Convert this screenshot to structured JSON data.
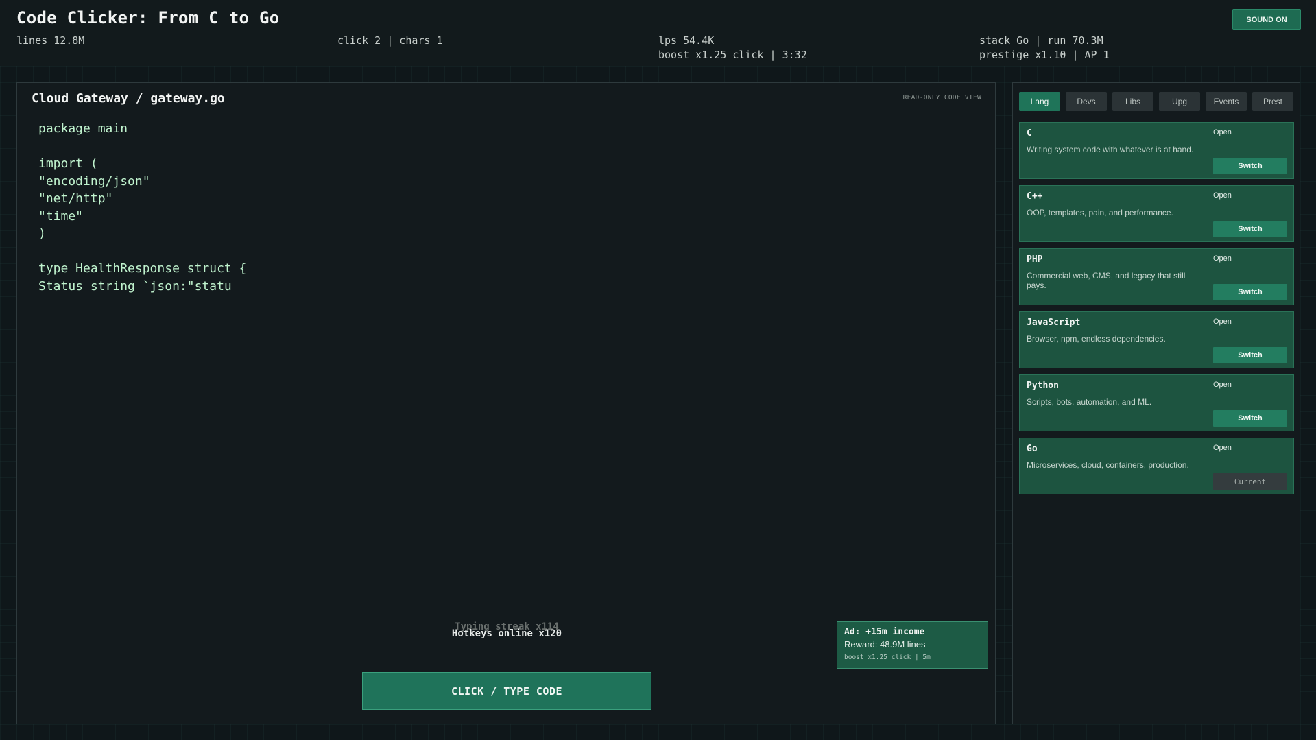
{
  "app": {
    "title": "Code Clicker: From C to Go",
    "sound_label": "SOUND ON"
  },
  "stats": {
    "lines": "lines 12.8M",
    "click": "click 2 | chars 1",
    "lps": "lps 54.4K",
    "boost": "boost x1.25 click | 3:32",
    "stack": "stack Go | run 70.3M",
    "prestige": "prestige x1.10 | AP 1"
  },
  "editor": {
    "file_title": "Cloud Gateway / gateway.go",
    "readonly_label": "READ-ONLY CODE VIEW",
    "code_lines": [
      "package main",
      "",
      "import (",
      "\"encoding/json\"",
      "\"net/http\"",
      "\"time\"",
      ")",
      "",
      "type HealthResponse struct {",
      "Status string `json:\"statu"
    ],
    "streak_ghost": "Typing streak x114",
    "streak_main": "Hotkeys online x120",
    "click_button": "CLICK / TYPE CODE"
  },
  "ad": {
    "title": "Ad: +15m income",
    "reward": "Reward: 48.9M lines",
    "sub": "boost x1.25 click | 5m"
  },
  "tabs": [
    {
      "label": "Lang",
      "active": true
    },
    {
      "label": "Devs",
      "active": false
    },
    {
      "label": "Libs",
      "active": false
    },
    {
      "label": "Upg",
      "active": false
    },
    {
      "label": "Events",
      "active": false
    },
    {
      "label": "Prest",
      "active": false
    }
  ],
  "languages": [
    {
      "name": "C",
      "status": "Open",
      "desc": "Writing system code with whatever is at hand.",
      "action": "Switch"
    },
    {
      "name": "C++",
      "status": "Open",
      "desc": "OOP, templates, pain, and performance.",
      "action": "Switch"
    },
    {
      "name": "PHP",
      "status": "Open",
      "desc": "Commercial web, CMS, and legacy that still pays.",
      "action": "Switch"
    },
    {
      "name": "JavaScript",
      "status": "Open",
      "desc": "Browser, npm, endless dependencies.",
      "action": "Switch"
    },
    {
      "name": "Python",
      "status": "Open",
      "desc": "Scripts, bots, automation, and ML.",
      "action": "Switch"
    },
    {
      "name": "Go",
      "status": "Open",
      "desc": "Microservices, cloud, containers, production.",
      "action": "Current"
    }
  ],
  "colors": {
    "accent": "#1f7459",
    "background": "#0f171a",
    "code_text": "#bff2cd"
  }
}
